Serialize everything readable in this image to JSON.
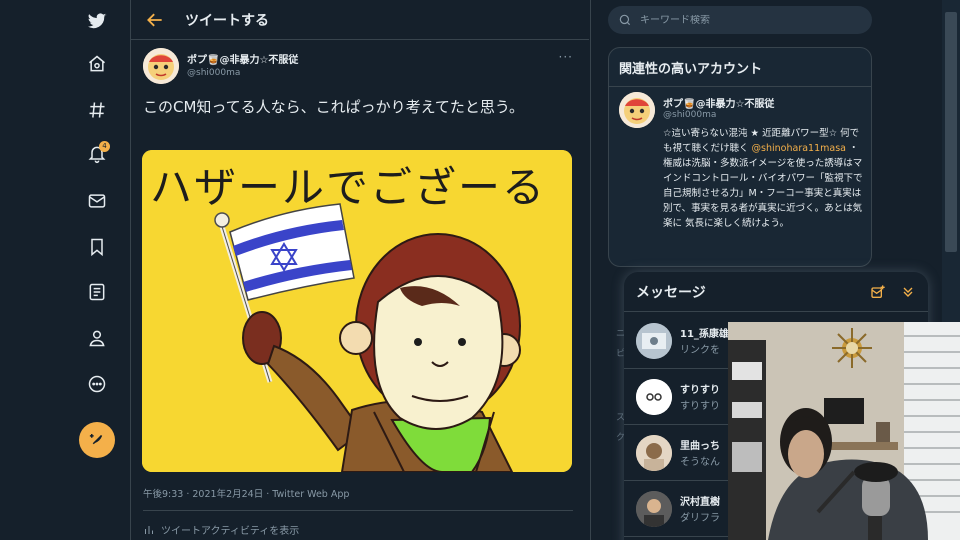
{
  "header": {
    "title": "ツイートする"
  },
  "tweet": {
    "author_name": "ポプ🥃@非暴力☆不服従",
    "author_handle": "@shi000ma",
    "more": "···",
    "text": "このCM知ってる人なら、これぱっかり考えてたと思う。",
    "image_text": "ハザールでござーる",
    "meta": "午後9:33 · 2021年2月24日 · Twitter Web App",
    "activity": "ツイートアクティビティを表示"
  },
  "nav": {
    "notification_count": "4"
  },
  "search": {
    "placeholder": "キーワード検索"
  },
  "related": {
    "title": "関連性の高いアカウント",
    "name": "ポプ🥃@非暴力☆不服従",
    "handle": "@shi000ma",
    "bio_1": "☆這い寄らない混沌 ★ 近距離パワー型☆ 何でも視て聴くだけ聴く ",
    "bio_mention": "@shinohara11masa",
    "bio_2": " ・権威は洗脳・多数派イメージを使った誘導はマインドコントロール・バイオパワー「監視下で自己規制させる力」M・フーコー事実と真実は別で、事実を見る者が真実に近づく。あとは気楽に 気長に楽しく続けよう。"
  },
  "messages": {
    "title": "メッセージ",
    "items": [
      {
        "name": "11_孫康雄",
        "preview": "リンクを"
      },
      {
        "name": "すりすり",
        "preview": "すりすり"
      },
      {
        "name": "里曲っち",
        "preview": "そうなん"
      },
      {
        "name": "沢村直樹",
        "preview": "ダリフラ"
      }
    ]
  },
  "colors": {
    "background": "#15202b",
    "accent": "#f4b04a",
    "border": "#38444d",
    "muted_text": "#8899a6"
  }
}
